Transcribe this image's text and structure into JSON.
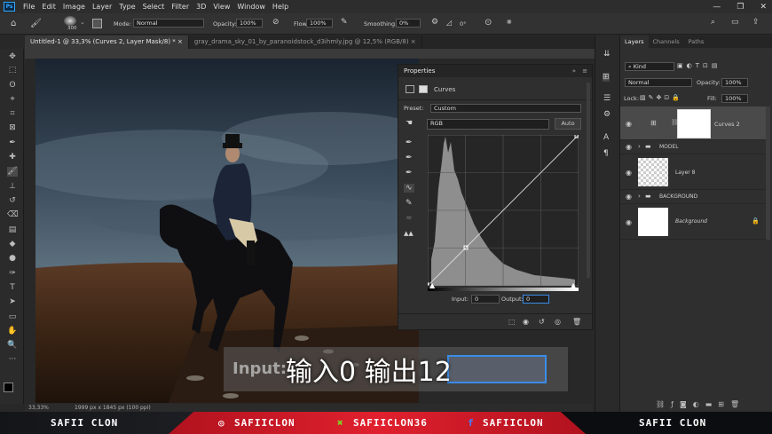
{
  "menu": {
    "app_icon": "Ps",
    "items": [
      "File",
      "Edit",
      "Image",
      "Layer",
      "Type",
      "Select",
      "Filter",
      "3D",
      "View",
      "Window",
      "Help"
    ],
    "window_controls": [
      "—",
      "❐",
      "✕"
    ]
  },
  "options": {
    "brush_size": "300",
    "mode_label": "Mode:",
    "mode_value": "Normal",
    "opacity_label": "Opacity:",
    "opacity_value": "100%",
    "flow_label": "Flow:",
    "flow_value": "100%",
    "smoothing_label": "Smoothing:",
    "smoothing_value": "0%",
    "angle_value": "0°"
  },
  "tabs": [
    {
      "label": "Untitled-1 @ 33,3% (Curves 2, Layer Mask/8) *",
      "close": "×"
    },
    {
      "label": "gray_drama_sky_01_by_paranoidstock_d3ihmly.jpg @ 12,5% (RGB/8)",
      "close": "×"
    }
  ],
  "status": {
    "zoom": "33,33%",
    "doc_info": "1999 px x 1845 px (100 ppi)"
  },
  "properties": {
    "title": "Properties",
    "panel_name": "Curves",
    "preset_label": "Preset:",
    "preset_value": "Custom",
    "channel_value": "RGB",
    "auto_label": "Auto",
    "input_label": "Input:",
    "input_value": "0",
    "output_label": "Output:",
    "output_value": "0"
  },
  "layers_panel": {
    "tabs": [
      "Layers",
      "Channels",
      "Paths"
    ],
    "kind_label": "Kind",
    "blend_mode": "Normal",
    "opacity_label": "Opacity:",
    "opacity_value": "100%",
    "lock_label": "Lock:",
    "fill_label": "Fill:",
    "fill_value": "100%",
    "layers": [
      {
        "name": "Curves 2",
        "type": "adjustment"
      },
      {
        "name": "MODEL",
        "type": "group"
      },
      {
        "name": "Layer 8",
        "type": "pixel"
      },
      {
        "name": "BACKGROUND",
        "type": "group"
      },
      {
        "name": "Background",
        "type": "background"
      }
    ]
  },
  "subtitle": {
    "ghost_text": "Input:",
    "text": "输入0 输出12"
  },
  "banner": {
    "left_name": "SAFII CLON",
    "instagram": "SAFIICLON",
    "xbox": "SAFIICLON36",
    "facebook": "SAFIICLON",
    "right_name": "SAFII CLON"
  }
}
